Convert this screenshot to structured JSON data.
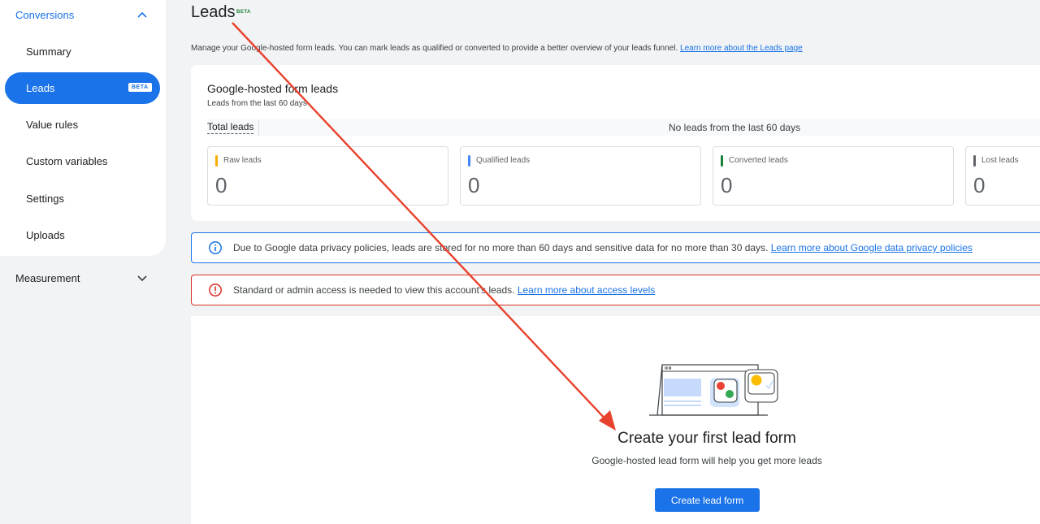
{
  "sidebar": {
    "section": "Conversions",
    "items": [
      {
        "label": "Summary"
      },
      {
        "label": "Leads",
        "badge": "BETA",
        "active": true
      },
      {
        "label": "Value rules"
      },
      {
        "label": "Custom variables"
      },
      {
        "label": "Settings"
      },
      {
        "label": "Uploads"
      }
    ],
    "measurement": "Measurement"
  },
  "page": {
    "title": "Leads",
    "badge": "BETA",
    "description": "Manage your Google-hosted form leads. You can mark leads as qualified or converted to provide a better overview of your leads funnel.",
    "description_link": "Learn more about the Leads page"
  },
  "leads_card": {
    "title": "Google-hosted form leads",
    "subtitle": "Leads from the last 60 days",
    "tab": "Total leads",
    "empty_message": "No leads from the last 60 days",
    "stats": [
      {
        "label": "Raw leads",
        "value": "0",
        "color": "#f9ab00"
      },
      {
        "label": "Qualified leads",
        "value": "0",
        "color": "#4285f4"
      },
      {
        "label": "Converted leads",
        "value": "0",
        "color": "#188038"
      },
      {
        "label": "Lost leads",
        "value": "0",
        "color": "#5f6368"
      }
    ]
  },
  "info_banner": {
    "icon": "info-icon",
    "text": "Due to Google data privacy policies, leads are stored for no more than 60 days and sensitive data for no more than 30 days.",
    "link": "Learn more about Google data privacy policies",
    "color": "#1a73e8"
  },
  "error_banner": {
    "icon": "error-icon",
    "text": "Standard or admin access is needed to view this account's leads.",
    "link": "Learn more about access levels",
    "color": "#d93025"
  },
  "empty_state": {
    "title": "Create your first lead form",
    "subtitle": "Google-hosted lead form will help you get more leads",
    "button": "Create lead form"
  },
  "annotation": {
    "color": "#e8412c"
  }
}
